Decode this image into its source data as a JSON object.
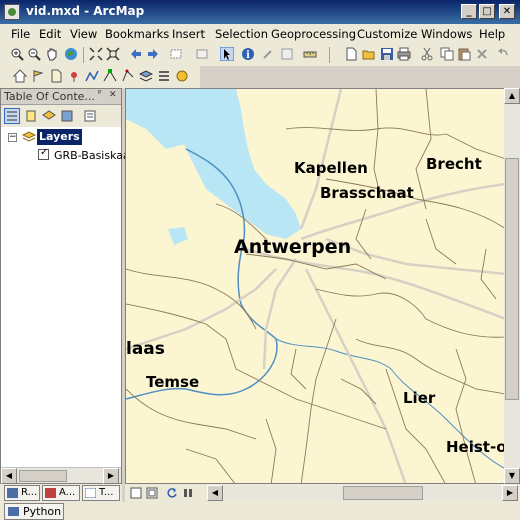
{
  "window": {
    "title": "vid.mxd - ArcMap",
    "minimize": "_",
    "maximize": "□",
    "close": "✕"
  },
  "menu": {
    "items": [
      "File",
      "Edit",
      "View",
      "Bookmarks",
      "Insert",
      "Selection",
      "Geoprocessing",
      "Customize",
      "Windows",
      "Help"
    ]
  },
  "toc": {
    "title": "Table Of Conte...",
    "pin": "ᴾ",
    "close": "✕",
    "root_label": "Layers",
    "layer_label": "GRB-Basiskaa",
    "tabs": [
      {
        "label": "R...",
        "icon": "list-by-drawing-order-icon"
      },
      {
        "label": "A...",
        "icon": "list-by-source-icon"
      },
      {
        "label": "T...",
        "icon": "list-by-visibility-icon"
      }
    ]
  },
  "map": {
    "places": [
      "Kapellen",
      "Brecht",
      "Brasschaat",
      "Antwerpen",
      "laas",
      "Temse",
      "Lier",
      "Heist-o"
    ],
    "colors": {
      "land": "#fbf5d2",
      "water": "#b8e6f5",
      "river": "#4e8fc4",
      "boundary": "#8c7a58",
      "road": "#d6d1c4"
    }
  },
  "status": {
    "python_tab": "Python"
  }
}
